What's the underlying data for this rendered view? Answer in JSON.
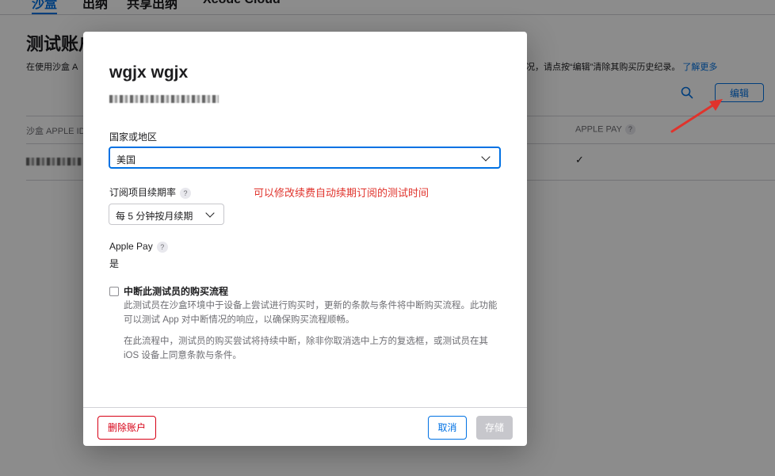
{
  "background": {
    "tabs": [
      "沙盒",
      "出纳",
      "共享出纳",
      "Xcode Cloud"
    ],
    "title": "测试账户",
    "description_left": "在使用沙盒 A",
    "description_right": "况，请点按“编辑”清除其购买历史纪录。",
    "learn_more": "了解更多",
    "edit_button": "编辑",
    "table": {
      "col_apple_id": "沙盒 APPLE ID",
      "col_apple_pay": "APPLE PAY",
      "help": "?",
      "row_check": "✓"
    }
  },
  "modal": {
    "name": "wgjx wgjx",
    "country_label": "国家或地区",
    "country_value": "美国",
    "renewal_label": "订阅项目续期率",
    "renewal_help": "?",
    "renewal_value": "每 5 分钟按月续期",
    "annotation": "可以修改续费自动续期订阅的测试时间",
    "apple_pay_label": "Apple Pay",
    "apple_pay_help": "?",
    "apple_pay_value": "是",
    "interrupt_label": "中断此测试员的购买流程",
    "interrupt_desc1": "此测试员在沙盒环境中于设备上尝试进行购买时，更新的条款与条件将中断购买流程。此功能可以测试 App 对中断情况的响应，以确保购买流程顺畅。",
    "interrupt_desc2": "在此流程中，测试员的购买尝试将持续中断，除非你取消选中上方的复选框，或测试员在其 iOS 设备上同意条款与条件。",
    "delete_button": "删除账户",
    "cancel_button": "取消",
    "save_button": "存储"
  },
  "colors": {
    "accent": "#0071e3",
    "danger": "#d70015",
    "annotation": "#e0332c"
  }
}
